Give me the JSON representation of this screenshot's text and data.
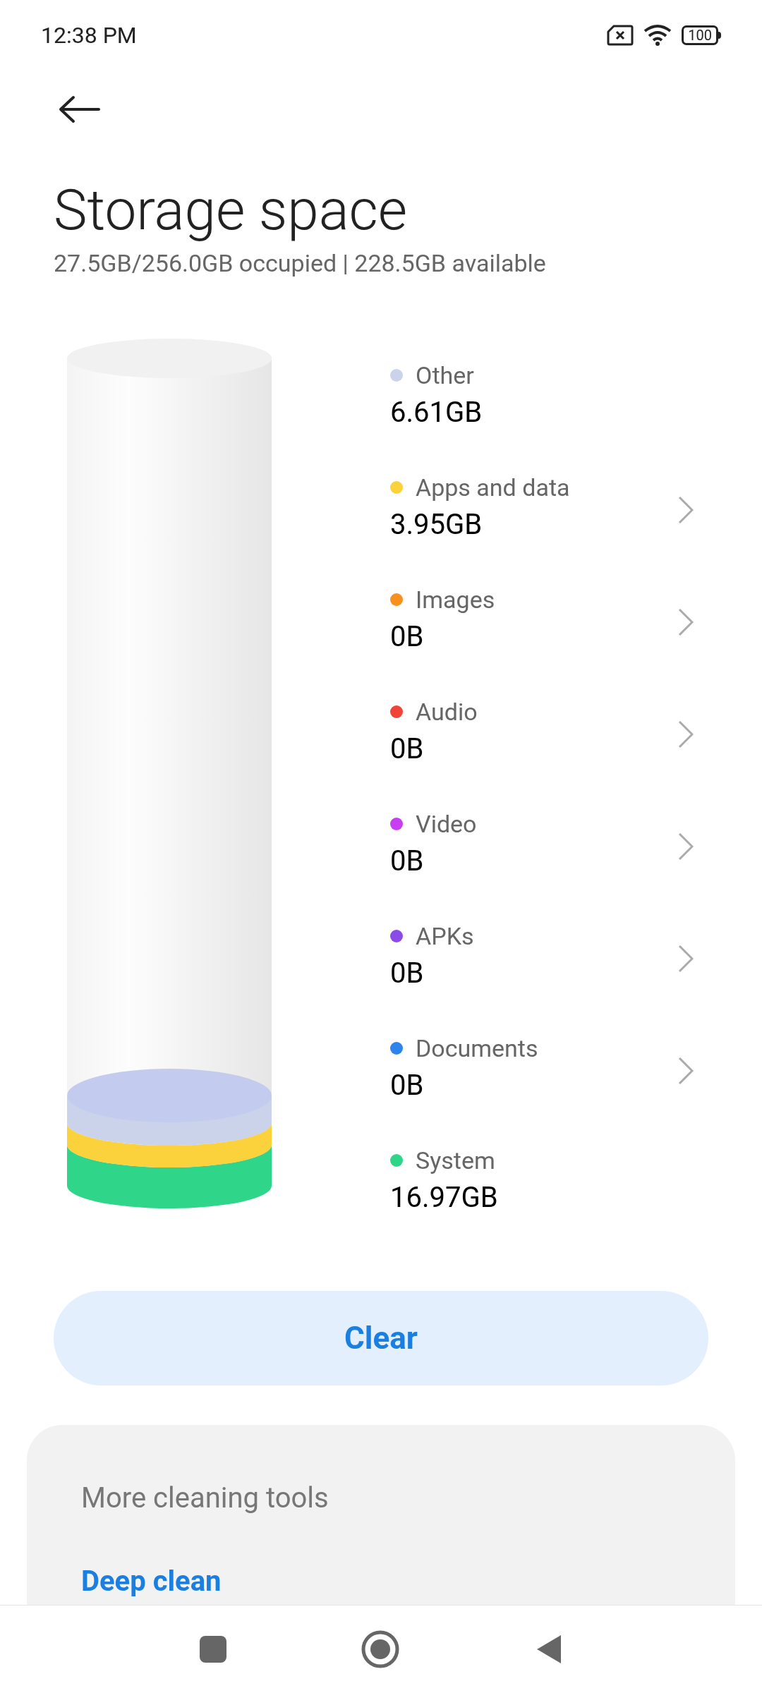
{
  "status_bar": {
    "time": "12:38 PM",
    "battery": "100"
  },
  "header": {
    "title": "Storage space",
    "summary": "27.5GB/256.0GB occupied | 228.5GB available"
  },
  "categories": [
    {
      "label": "Other",
      "size": "6.61GB",
      "color": "#cbd3ea",
      "chevron": false
    },
    {
      "label": "Apps and data",
      "size": "3.95GB",
      "color": "#fbd23c",
      "chevron": true
    },
    {
      "label": "Images",
      "size": "0B",
      "color": "#f7901e",
      "chevron": true
    },
    {
      "label": "Audio",
      "size": "0B",
      "color": "#f04438",
      "chevron": true
    },
    {
      "label": "Video",
      "size": "0B",
      "color": "#c63ef0",
      "chevron": true
    },
    {
      "label": "APKs",
      "size": "0B",
      "color": "#8a4be8",
      "chevron": true
    },
    {
      "label": "Documents",
      "size": "0B",
      "color": "#2c84ec",
      "chevron": true
    },
    {
      "label": "System",
      "size": "16.97GB",
      "color": "#2fd68a",
      "chevron": false
    }
  ],
  "clear_button": "Clear",
  "tools_card": {
    "title": "More cleaning tools",
    "items": [
      "Deep clean"
    ]
  }
}
